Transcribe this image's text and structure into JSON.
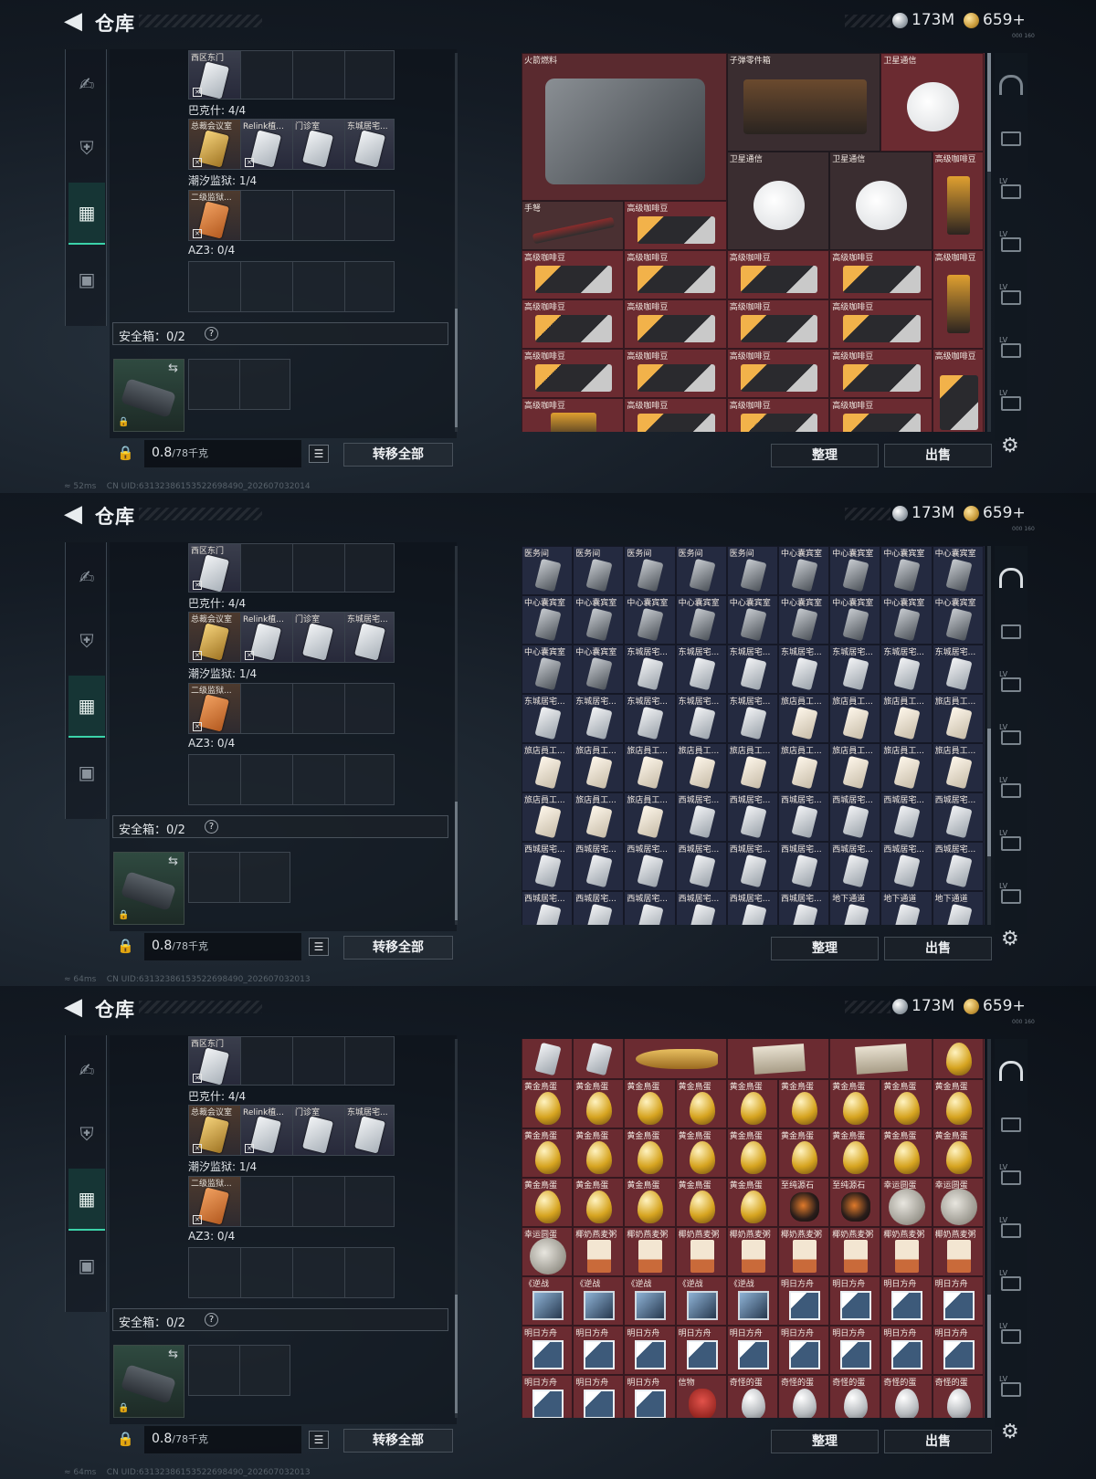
{
  "header": {
    "title": "仓库",
    "silver_amount": "173M",
    "gold_amount": "659+",
    "version": "000 160"
  },
  "left": {
    "top_item_label": "西区东门",
    "row_labels": [
      "巴克什: 4/4",
      "潮汐监狱: 1/4",
      "AZ3: 0/4"
    ],
    "bakesh_items": [
      "总裁会议室",
      "Relink植...",
      "门诊室",
      "东城居宅..."
    ],
    "tidal_items": [
      "二级监狱..."
    ],
    "safe_box_label": "安全箱：0/2",
    "safe_help": "?",
    "weight_value": "0.8",
    "weight_max": "/78千克",
    "transfer_all": "转移全部"
  },
  "actions": {
    "sort": "整理",
    "sell": "出售"
  },
  "sidebar_lv": "LV",
  "panels": [
    {
      "theme": "red",
      "status": "52ms",
      "uid": "CN UID:631323861535226984​90_202607032014",
      "stash_items": [
        {
          "name": "火箭燃料",
          "icon": "jerrycan-icon"
        },
        {
          "name": "子弹零件箱",
          "icon": "ammo-parts-box-icon"
        },
        {
          "name": "卫星通信",
          "icon": "satellite-dish-icon"
        },
        {
          "name": "卫星通信",
          "icon": "satellite-dish-icon"
        },
        {
          "name": "卫星通信",
          "icon": "satellite-dish-icon"
        },
        {
          "name": "高级咖啡豆",
          "icon": "coffee-bag-icon"
        },
        {
          "name": "手弩",
          "icon": "crossbow-icon"
        },
        {
          "name": "高级咖啡豆",
          "icon": "coffee-box-icon"
        },
        {
          "name": "高级咖啡豆",
          "icon": "coffee-box-icon"
        },
        {
          "name": "高级咖啡豆",
          "icon": "coffee-box-icon"
        },
        {
          "name": "高级咖啡豆",
          "icon": "coffee-box-icon"
        },
        {
          "name": "高级咖啡豆",
          "icon": "coffee-box-icon"
        },
        {
          "name": "高级咖啡豆",
          "icon": "coffee-bag-icon"
        },
        {
          "name": "高级咖啡豆",
          "icon": "coffee-box-icon"
        },
        {
          "name": "高级咖啡豆",
          "icon": "coffee-box-icon"
        },
        {
          "name": "高级咖啡豆",
          "icon": "coffee-box-icon"
        },
        {
          "name": "高级咖啡豆",
          "icon": "coffee-box-icon"
        },
        {
          "name": "高级咖啡豆",
          "icon": "coffee-box-icon"
        },
        {
          "name": "高级咖啡豆",
          "icon": "coffee-box-icon"
        },
        {
          "name": "高级咖啡豆",
          "icon": "coffee-box-icon"
        },
        {
          "name": "高级咖啡豆",
          "icon": "coffee-box-icon"
        },
        {
          "name": "高级咖啡豆",
          "icon": "coffee-box-icon"
        },
        {
          "name": "高级咖啡豆",
          "icon": "coffee-bag-icon"
        },
        {
          "name": "高级咖啡豆",
          "icon": "coffee-box-icon"
        },
        {
          "name": "高级咖啡豆",
          "icon": "coffee-box-icon"
        },
        {
          "name": "高级咖啡豆",
          "icon": "coffee-box-icon"
        },
        {
          "name": "高级咖啡豆",
          "icon": "coffee-box-icon"
        }
      ]
    },
    {
      "theme": "blue",
      "status": "64ms",
      "uid": "CN UID:63132386153522698490_202607032013",
      "stash_rows": [
        [
          "医务间",
          "医务间",
          "医务间",
          "医务间",
          "医务间",
          "中心囊宾室",
          "中心囊宾室",
          "中心囊宾室",
          "中心囊宾室"
        ],
        [
          "中心囊宾室",
          "中心囊宾室",
          "中心囊宾室",
          "中心囊宾室",
          "中心囊宾室",
          "中心囊宾室",
          "中心囊宾室",
          "中心囊宾室",
          "中心囊宾室"
        ],
        [
          "中心囊宾室",
          "中心囊宾室",
          "东城居宅...",
          "东城居宅...",
          "东城居宅...",
          "东城居宅...",
          "东城居宅...",
          "东城居宅...",
          "东城居宅..."
        ],
        [
          "东城居宅...",
          "东城居宅...",
          "东城居宅...",
          "东城居宅...",
          "东城居宅...",
          "旅店員工...",
          "旅店員工...",
          "旅店員工...",
          "旅店員工..."
        ],
        [
          "旅店員工...",
          "旅店員工...",
          "旅店員工...",
          "旅店員工...",
          "旅店員工...",
          "旅店員工...",
          "旅店員工...",
          "旅店員工...",
          "旅店員工..."
        ],
        [
          "旅店員工...",
          "旅店員工...",
          "旅店員工...",
          "西城居宅...",
          "西城居宅...",
          "西城居宅...",
          "西城居宅...",
          "西城居宅...",
          "西城居宅..."
        ],
        [
          "西城居宅...",
          "西城居宅...",
          "西城居宅...",
          "西城居宅...",
          "西城居宅...",
          "西城居宅...",
          "西城居宅...",
          "西城居宅...",
          "西城居宅..."
        ],
        [
          "西城居宅...",
          "西城居宅...",
          "西城居宅...",
          "西城居宅...",
          "西城居宅...",
          "西城居宅...",
          "地下通道",
          "地下通道",
          "地下通道"
        ]
      ]
    },
    {
      "theme": "red",
      "status": "64ms",
      "uid": "CN UID:63132386153522698490_202607032013",
      "stash_rows": [
        [
          [
            "",
            "card"
          ],
          [
            "",
            "card"
          ],
          [
            "",
            "fish"
          ],
          [
            "",
            "paper"
          ],
          [
            "",
            "paper"
          ],
          [
            "",
            "egg"
          ]
        ],
        [
          [
            "黄金鳥蛋",
            "egg"
          ],
          [
            "黄金鳥蛋",
            "egg"
          ],
          [
            "黄金鳥蛋",
            "egg"
          ],
          [
            "黄金鳥蛋",
            "egg"
          ],
          [
            "黄金鳥蛋",
            "egg"
          ],
          [
            "黄金鳥蛋",
            "egg"
          ],
          [
            "黄金鳥蛋",
            "egg"
          ],
          [
            "黄金鳥蛋",
            "egg"
          ],
          [
            "黄金鳥蛋",
            "egg"
          ]
        ],
        [
          [
            "黄金鳥蛋",
            "egg"
          ],
          [
            "黄金鳥蛋",
            "egg"
          ],
          [
            "黄金鳥蛋",
            "egg"
          ],
          [
            "黄金鳥蛋",
            "egg"
          ],
          [
            "黄金鳥蛋",
            "egg"
          ],
          [
            "黄金鳥蛋",
            "egg"
          ],
          [
            "黄金鳥蛋",
            "egg"
          ],
          [
            "黄金鳥蛋",
            "egg"
          ],
          [
            "黄金鳥蛋",
            "egg"
          ]
        ],
        [
          [
            "黄金鳥蛋",
            "egg"
          ],
          [
            "黄金鳥蛋",
            "egg"
          ],
          [
            "黄金鳥蛋",
            "egg"
          ],
          [
            "黄金鳥蛋",
            "egg"
          ],
          [
            "黄金鳥蛋",
            "egg"
          ],
          [
            "至纯源石",
            "stone"
          ],
          [
            "至纯源石",
            "stone"
          ],
          [
            "幸运圆蛋",
            "moon"
          ],
          [
            "幸运圆蛋",
            "moon"
          ]
        ],
        [
          [
            "幸运圆蛋",
            "moon"
          ],
          [
            "椰奶燕麦粥",
            "box"
          ],
          [
            "椰奶燕麦粥",
            "box"
          ],
          [
            "椰奶燕麦粥",
            "box"
          ],
          [
            "椰奶燕麦粥",
            "box"
          ],
          [
            "椰奶燕麦粥",
            "box"
          ],
          [
            "椰奶燕麦粥",
            "box"
          ],
          [
            "椰奶燕麦粥",
            "box"
          ],
          [
            "椰奶燕麦粥",
            "box"
          ]
        ],
        [
          [
            "《逆战",
            "cd"
          ],
          [
            "《逆战",
            "cd"
          ],
          [
            "《逆战",
            "cd"
          ],
          [
            "《逆战",
            "cd"
          ],
          [
            "《逆战",
            "cd"
          ],
          [
            "明日方舟",
            "cd2"
          ],
          [
            "明日方舟",
            "cd2"
          ],
          [
            "明日方舟",
            "cd2"
          ],
          [
            "明日方舟",
            "cd2"
          ]
        ],
        [
          [
            "明日方舟",
            "cd2"
          ],
          [
            "明日方舟",
            "cd2"
          ],
          [
            "明日方舟",
            "cd2"
          ],
          [
            "明日方舟",
            "cd2"
          ],
          [
            "明日方舟",
            "cd2"
          ],
          [
            "明日方舟",
            "cd2"
          ],
          [
            "明日方舟",
            "cd2"
          ],
          [
            "明日方舟",
            "cd2"
          ],
          [
            "明日方舟",
            "cd2"
          ]
        ],
        [
          [
            "明日方舟",
            "cd2"
          ],
          [
            "明日方舟",
            "cd2"
          ],
          [
            "明日方舟",
            "cd2"
          ],
          [
            "信物",
            "skull"
          ],
          [
            "奇怪的蛋",
            "wegg"
          ],
          [
            "奇怪的蛋",
            "wegg"
          ],
          [
            "奇怪的蛋",
            "wegg"
          ],
          [
            "奇怪的蛋",
            "wegg"
          ],
          [
            "奇怪的蛋",
            "wegg"
          ]
        ]
      ]
    }
  ]
}
